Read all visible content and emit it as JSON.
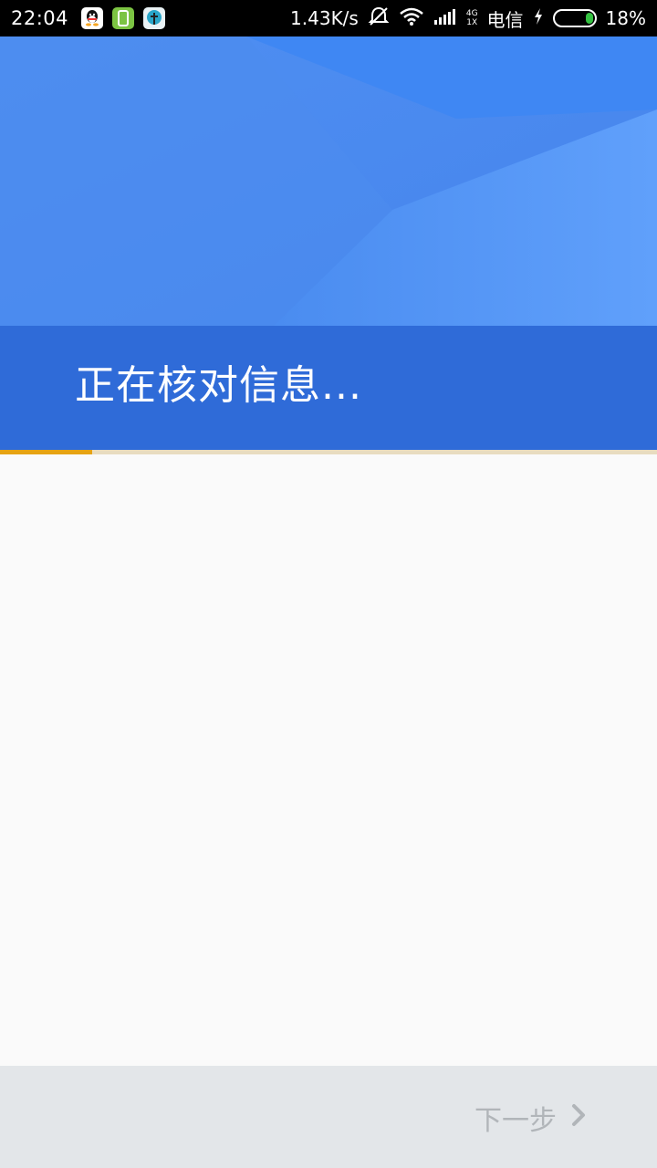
{
  "status_bar": {
    "time": "22:04",
    "network_speed": "1.43K/s",
    "network_type_top": "4G",
    "network_type_bottom": "1X",
    "carrier": "电信",
    "battery_percent": "18%",
    "battery_level": 0.18,
    "app_icons": [
      "qq-icon",
      "phone-icon",
      "tree-icon"
    ]
  },
  "header": {
    "title": "正在核对信息...",
    "progress": 0.14
  },
  "footer": {
    "next_label": "下一步"
  },
  "colors": {
    "banner_blue": "#4a8bef",
    "strip_blue": "#2f6bd8",
    "progress_accent": "#e6a313",
    "footer_bg": "#e3e6e9",
    "disabled_text": "#b1b5b9"
  }
}
